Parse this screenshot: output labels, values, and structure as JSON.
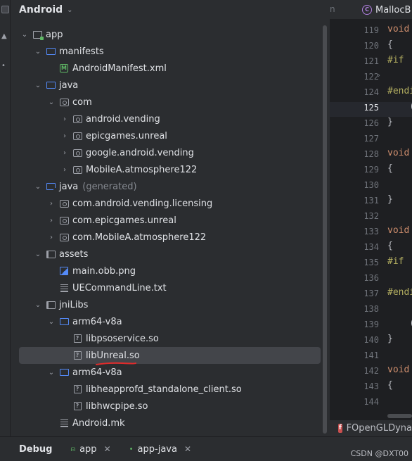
{
  "panel": {
    "title": "Android"
  },
  "tree": [
    {
      "label": "app",
      "icon": "module-icon",
      "expanded": true
    },
    {
      "label": "manifests",
      "icon": "folder-icon",
      "expanded": true
    },
    {
      "label": "AndroidManifest.xml",
      "icon": "manifest-file-icon"
    },
    {
      "label": "java",
      "icon": "folder-icon",
      "expanded": true
    },
    {
      "label": "com",
      "icon": "package-icon",
      "expanded": true
    },
    {
      "label": "android.vending",
      "icon": "package-icon",
      "expanded": false
    },
    {
      "label": "epicgames.unreal",
      "icon": "package-icon",
      "expanded": false
    },
    {
      "label": "google.android.vending",
      "icon": "package-icon",
      "expanded": false
    },
    {
      "label": "MobileA.atmosphere122",
      "icon": "package-icon",
      "expanded": false
    },
    {
      "label": "java",
      "suffix": "(generated)",
      "icon": "generated-folder-icon",
      "expanded": true
    },
    {
      "label": "com.android.vending.licensing",
      "icon": "package-icon",
      "expanded": false
    },
    {
      "label": "com.epicgames.unreal",
      "icon": "package-icon",
      "expanded": false
    },
    {
      "label": "com.MobileA.atmosphere122",
      "icon": "package-icon",
      "expanded": false
    },
    {
      "label": "assets",
      "icon": "resource-folder-icon",
      "expanded": true
    },
    {
      "label": "main.obb.png",
      "icon": "image-file-icon"
    },
    {
      "label": "UECommandLine.txt",
      "icon": "text-file-icon"
    },
    {
      "label": "jniLibs",
      "icon": "resource-folder-icon",
      "expanded": true
    },
    {
      "label": "arm64-v8a",
      "icon": "folder-icon",
      "expanded": true
    },
    {
      "label": "libpsoservice.so",
      "icon": "unknown-file-icon"
    },
    {
      "label": "libUnreal.so",
      "icon": "unknown-file-icon",
      "selected": true
    },
    {
      "label": "arm64-v8a",
      "icon": "folder-icon",
      "expanded": true
    },
    {
      "label": "libheapprofd_standalone_client.so",
      "icon": "unknown-file-icon"
    },
    {
      "label": "libhwcpipe.so",
      "icon": "unknown-file-icon"
    },
    {
      "label": "Android.mk",
      "icon": "text-file-icon"
    }
  ],
  "editor": {
    "tab_prev": "n",
    "tab_active": "MallocB",
    "bottom_label": "FOpenGLDyna",
    "current_line": "125",
    "lines": [
      {
        "num": "119",
        "code": [
          {
            "t": "void",
            "c": "kw"
          },
          {
            "t": " ",
            "c": "plain"
          }
        ]
      },
      {
        "num": "120",
        "code": [
          {
            "t": "{",
            "c": "plain"
          }
        ]
      },
      {
        "num": "121",
        "code": [
          {
            "t": "#if ",
            "c": "pp"
          }
        ]
      },
      {
        "num": "122",
        "code": []
      },
      {
        "num": "124",
        "code": [
          {
            "t": "#endi",
            "c": "pp"
          }
        ]
      },
      {
        "num": "125",
        "code": [
          {
            "t": "    (",
            "c": "plain"
          }
        ]
      },
      {
        "num": "126",
        "code": [
          {
            "t": "}",
            "c": "plain"
          }
        ]
      },
      {
        "num": "127",
        "code": []
      },
      {
        "num": "128",
        "code": [
          {
            "t": "void",
            "c": "kw"
          }
        ]
      },
      {
        "num": "129",
        "code": [
          {
            "t": "{",
            "c": "plain"
          }
        ]
      },
      {
        "num": "130",
        "code": []
      },
      {
        "num": "131",
        "code": [
          {
            "t": "}",
            "c": "plain"
          }
        ]
      },
      {
        "num": "132",
        "code": []
      },
      {
        "num": "133",
        "code": [
          {
            "t": "void",
            "c": "kw"
          }
        ]
      },
      {
        "num": "134",
        "code": [
          {
            "t": "{",
            "c": "plain"
          }
        ]
      },
      {
        "num": "135",
        "code": [
          {
            "t": "#if ",
            "c": "pp"
          }
        ]
      },
      {
        "num": "136",
        "code": []
      },
      {
        "num": "137",
        "code": [
          {
            "t": "#endi",
            "c": "pp"
          }
        ]
      },
      {
        "num": "138",
        "code": []
      },
      {
        "num": "139",
        "code": [
          {
            "t": "    (",
            "c": "plain"
          }
        ]
      },
      {
        "num": "140",
        "code": [
          {
            "t": "}",
            "c": "plain"
          }
        ]
      },
      {
        "num": "141",
        "code": []
      },
      {
        "num": "142",
        "code": [
          {
            "t": "void",
            "c": "kw"
          }
        ]
      },
      {
        "num": "143",
        "code": [
          {
            "t": "{",
            "c": "plain"
          }
        ]
      },
      {
        "num": "144",
        "code": []
      }
    ]
  },
  "bottombar": {
    "title": "Debug",
    "tabs": [
      {
        "label": "app",
        "icon": "android-icon"
      },
      {
        "label": "app-java",
        "icon": "dot-icon"
      }
    ],
    "watermark": "CSDN @DXT00"
  },
  "colors": {
    "background": "#2b2d30",
    "editor_bg": "#1e1f22",
    "selection": "#43454a",
    "keyword": "#cf8e6d",
    "preprocessor": "#b3ae60",
    "folder_blue": "#548af7",
    "android_green": "#5fb865",
    "annotation_red": "#e02b2b"
  }
}
